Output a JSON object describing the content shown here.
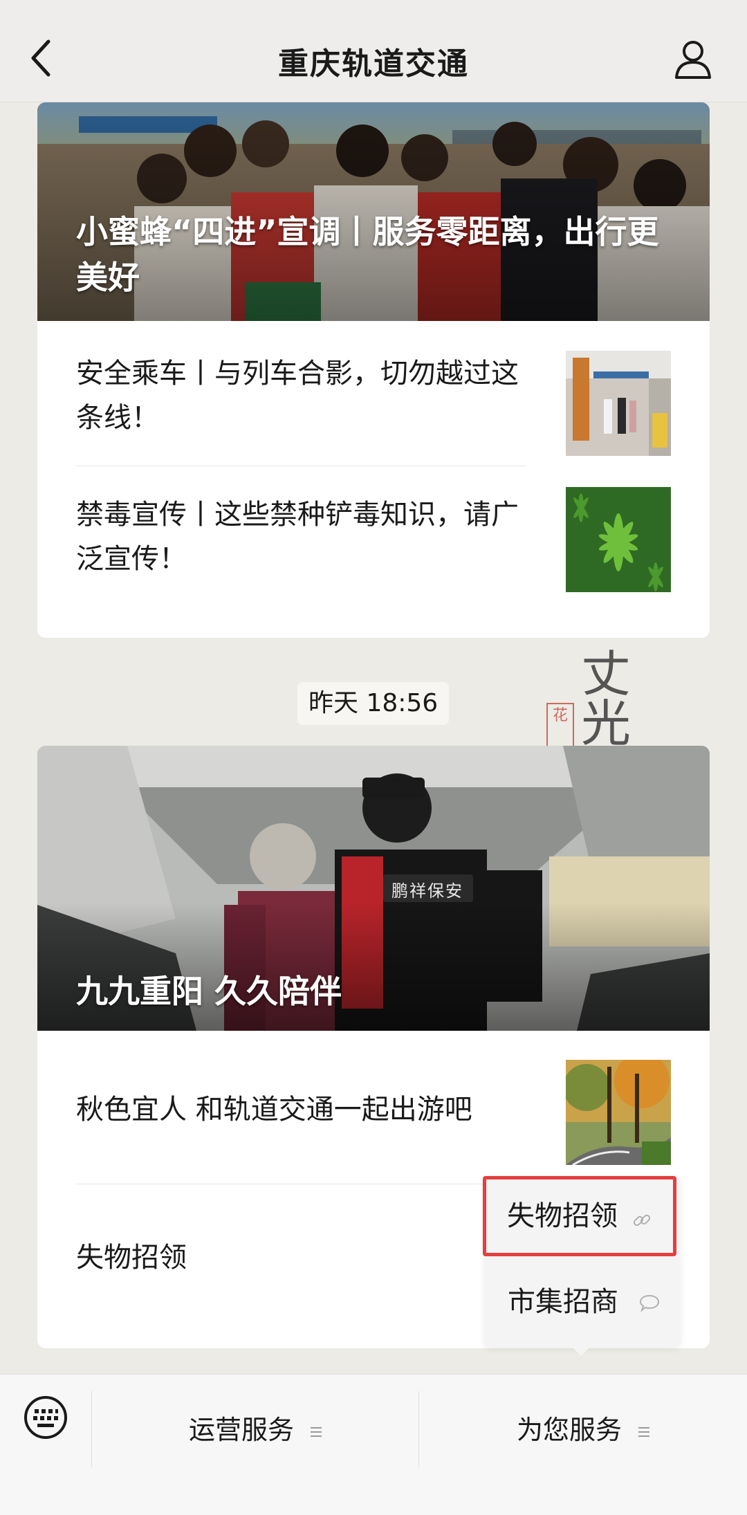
{
  "header": {
    "title": "重庆轨道交通",
    "back_icon": "back-chevron-icon",
    "profile_icon": "profile-icon"
  },
  "feed": {
    "group1": {
      "cover_title": "小蜜蜂“四进”宣调丨服务零距离，出行更美好",
      "items": [
        {
          "title": "安全乘车丨与列车合影，切勿越过这条线！",
          "thumb": "train-platform-photo"
        },
        {
          "title": "禁毒宣传丨这些禁种铲毒知识，请广泛宣传！",
          "thumb": "cannabis-leaf-photo"
        }
      ]
    },
    "timestamp": "昨天 18:56",
    "decoration": {
      "chars": "丈光",
      "seal": "花"
    },
    "group2": {
      "cover_title": "九九重阳 久久陪伴",
      "cover_badge": "鹏祥保安",
      "items": [
        {
          "title": "秋色宜人 和轨道交通一起出游吧",
          "thumb": "autumn-road-photo"
        },
        {
          "title": "失物招领",
          "thumb": ""
        }
      ]
    }
  },
  "popup_menu": {
    "items": [
      {
        "label": "失物招领",
        "icon": "link-icon",
        "highlighted": true
      },
      {
        "label": "市集招商",
        "icon": "chat-bubble-icon",
        "highlighted": false
      }
    ],
    "highlight_color": "#e53e3e"
  },
  "bottom_bar": {
    "keyboard_icon": "keyboard-icon",
    "menus": [
      {
        "label": "运营服务",
        "icon": "menu-lines-icon"
      },
      {
        "label": "为您服务",
        "icon": "menu-lines-icon"
      }
    ]
  }
}
